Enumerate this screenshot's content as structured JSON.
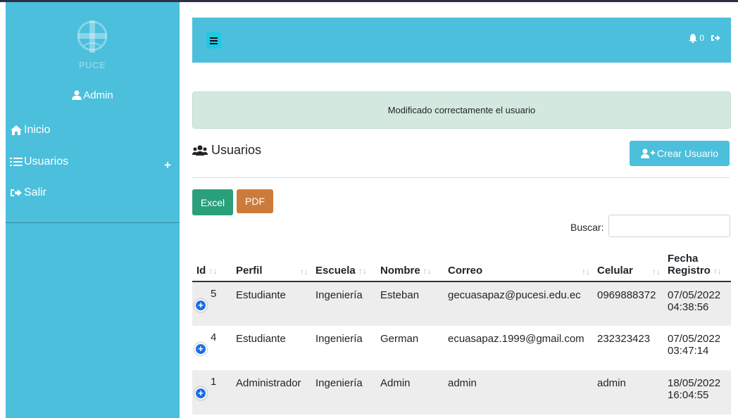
{
  "sidebar": {
    "logo_text": "PUCE",
    "user_name": "Admin",
    "items": [
      {
        "label": "Inicio",
        "icon": "home-icon"
      },
      {
        "label": "Usuarios",
        "icon": "list-icon",
        "expand": "+"
      },
      {
        "label": "Salir",
        "icon": "sign-out-icon"
      }
    ]
  },
  "topbar": {
    "menu_icon": "bars-icon",
    "notification_count": "0"
  },
  "alert": {
    "message": "Modificado correctamente el usuario"
  },
  "page": {
    "title": "Usuarios",
    "create_button": "Crear Usuario"
  },
  "export": {
    "excel": "Excel",
    "pdf": "PDF"
  },
  "search": {
    "label": "Buscar:",
    "value": ""
  },
  "table": {
    "headers": [
      "Id",
      "Perfil",
      "Escuela",
      "Nombre",
      "Correo",
      "Celular",
      "Fecha",
      "Registro"
    ],
    "rows": [
      {
        "id": "5",
        "perfil": "Estudiante",
        "escuela": "Ingeniería",
        "nombre": "Esteban",
        "correo": "gecuasapaz@pucesi.edu.ec",
        "celular": "0969888372",
        "fecha": "07/05/2022",
        "hora": "04:38:56"
      },
      {
        "id": "4",
        "perfil": "Estudiante",
        "escuela": "Ingeniería",
        "nombre": "German",
        "correo": "ecuasapaz.1999@gmail.com",
        "celular": "232323423",
        "fecha": "07/05/2022",
        "hora": "03:47:14"
      },
      {
        "id": "1",
        "perfil": "Administrador",
        "escuela": "Ingeniería",
        "nombre": "Admin",
        "correo": "admin",
        "celular": "admin",
        "fecha": "18/05/2022",
        "hora": "16:04:55"
      }
    ]
  },
  "colors": {
    "sidebar": "#4bbfdc",
    "excel": "#2aa07a",
    "pdf": "#cd7b3a",
    "alert_bg": "#d3e8df",
    "row_expand": "#1d6ee8"
  }
}
